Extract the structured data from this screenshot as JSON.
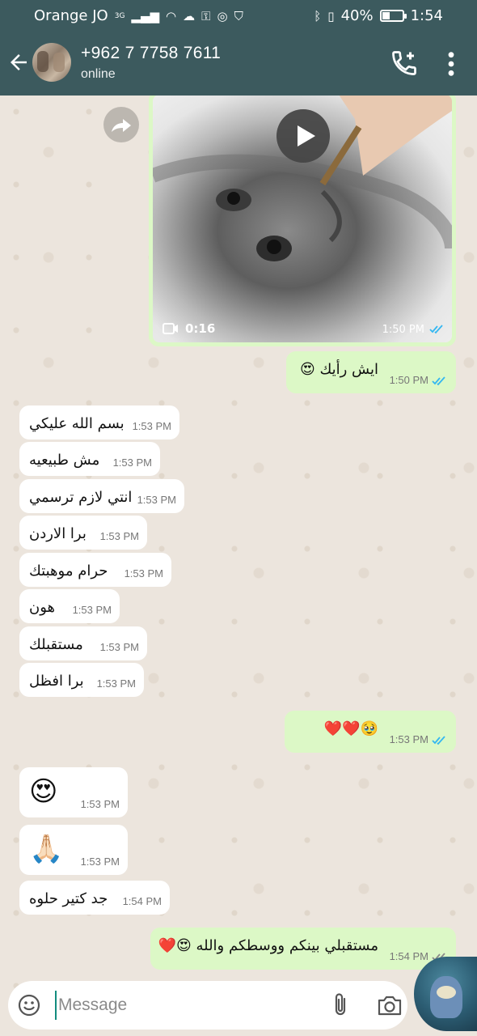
{
  "status_bar": {
    "carrier": "Orange JO",
    "network": "3G",
    "battery": "40%",
    "battery_level": 0.4,
    "time": "1:54"
  },
  "header": {
    "contact_name": "+962 7 7758 7611",
    "status": "online"
  },
  "video": {
    "duration": "0:16",
    "time": "1:50 PM"
  },
  "messages": [
    {
      "dir": "out",
      "text": "ايش رأيك 😍",
      "time": "1:50 PM",
      "read": true
    },
    {
      "dir": "in",
      "text": "بسم الله عليكي",
      "time": "1:53 PM"
    },
    {
      "dir": "in",
      "text": "مش طبيعيه",
      "time": "1:53 PM"
    },
    {
      "dir": "in",
      "text": "انتي لازم ترسمي",
      "time": "1:53 PM"
    },
    {
      "dir": "in",
      "text": "برا الاردن",
      "time": "1:53 PM"
    },
    {
      "dir": "in",
      "text": "حرام موهبتك",
      "time": "1:53 PM"
    },
    {
      "dir": "in",
      "text": "هون",
      "time": "1:53 PM"
    },
    {
      "dir": "in",
      "text": "مستقبلك",
      "time": "1:53 PM"
    },
    {
      "dir": "in",
      "text": "برا افظل",
      "time": "1:53 PM"
    },
    {
      "dir": "out",
      "text": "🥹❤️❤️",
      "time": "1:53 PM",
      "read": true
    },
    {
      "dir": "in",
      "text": "😍",
      "time": "1:53 PM"
    },
    {
      "dir": "in",
      "text": "🙏🏻",
      "time": "1:53 PM"
    },
    {
      "dir": "in",
      "text": "جد كتير حلوه",
      "time": "1:54 PM"
    },
    {
      "dir": "out",
      "text": "مستقبلي بينكم ووسطكم والله 😍❤️",
      "time": "1:54 PM",
      "read": false
    }
  ],
  "input": {
    "placeholder": "Message"
  },
  "colors": {
    "header": "#3c5a5e",
    "outgoing": "#dcf8c6",
    "incoming": "#ffffff",
    "read_ticks": "#34b7f1",
    "wallpaper": "#ece5dd"
  },
  "icons": [
    "back-arrow-icon",
    "add-call-icon",
    "more-vert-icon",
    "forward-icon",
    "play-icon",
    "video-camera-icon",
    "double-tick-icon",
    "emoji-icon",
    "attach-icon",
    "camera-icon"
  ]
}
